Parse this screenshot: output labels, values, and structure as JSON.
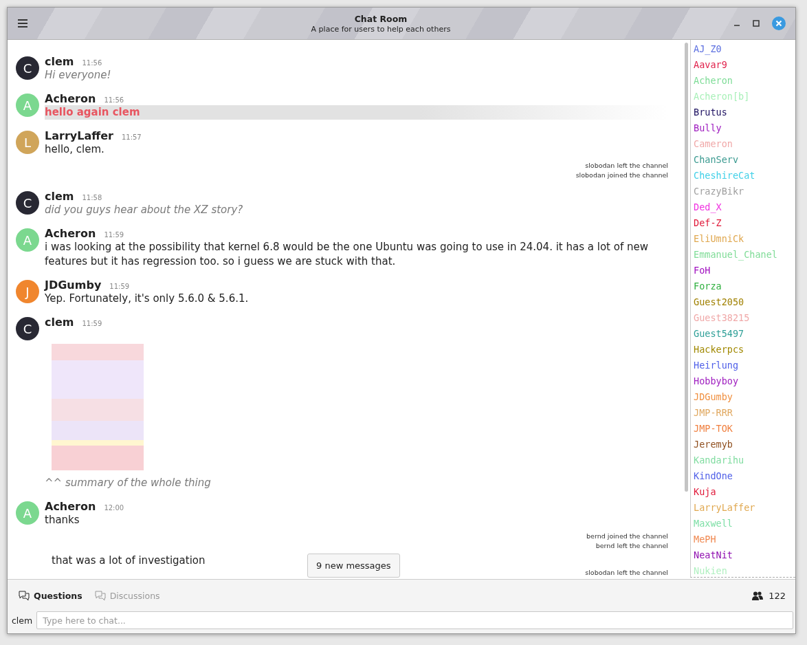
{
  "window": {
    "title": "Chat Room",
    "subtitle": "A place for users to help each others"
  },
  "feed": [
    {
      "kind": "message",
      "avatar": "C",
      "color": "#282833",
      "name": "clem",
      "time": "11:56",
      "parts": [
        {
          "kind": "emote",
          "text": "Hi everyone!"
        }
      ]
    },
    {
      "kind": "message",
      "avatar": "A",
      "color": "#7bd88f",
      "name": "Acheron",
      "time": "11:56",
      "parts": [
        {
          "kind": "highlight",
          "text": "hello again clem"
        }
      ]
    },
    {
      "kind": "message",
      "avatar": "L",
      "color": "#d0a55a",
      "name": "LarryLaffer",
      "time": "11:57",
      "parts": [
        {
          "kind": "text",
          "text": "hello, clem."
        }
      ]
    },
    {
      "kind": "notice",
      "text": "slobodan left the channel"
    },
    {
      "kind": "notice",
      "text": "slobodan joined the channel"
    },
    {
      "kind": "message",
      "avatar": "C",
      "color": "#282833",
      "name": "clem",
      "time": "11:58",
      "parts": [
        {
          "kind": "emote",
          "text": "did you guys hear about the XZ story?"
        }
      ]
    },
    {
      "kind": "message",
      "avatar": "A",
      "color": "#7bd88f",
      "name": "Acheron",
      "time": "11:59",
      "parts": [
        {
          "kind": "text",
          "text": "i was looking at the possibility that kernel 6.8 would be the one Ubuntu was going to use in 24.04. it has a lot of new features but it has regression too. so i guess we are stuck with that."
        }
      ]
    },
    {
      "kind": "message",
      "avatar": "J",
      "color": "#f0862e",
      "name": "JDGumby",
      "time": "11:59",
      "parts": [
        {
          "kind": "text",
          "text": "Yep. Fortunately, it's only 5.6.0 & 5.6.1."
        }
      ]
    },
    {
      "kind": "message",
      "avatar": "C",
      "color": "#282833",
      "name": "clem",
      "time": "11:59",
      "parts": [
        {
          "kind": "image"
        },
        {
          "kind": "emote",
          "text": "^^ summary of the whole thing"
        }
      ]
    },
    {
      "kind": "message",
      "avatar": "A",
      "color": "#7bd88f",
      "name": "Acheron",
      "time": "12:00",
      "parts": [
        {
          "kind": "text",
          "text": "thanks"
        }
      ]
    },
    {
      "kind": "notice",
      "text": "bernd joined the channel"
    },
    {
      "kind": "notice",
      "text": "bernd left the channel"
    },
    {
      "kind": "continuation",
      "text": "that was a lot of investigation"
    },
    {
      "kind": "notice",
      "text": "slobodan left the channel"
    }
  ],
  "new_messages_button": "9 new messages",
  "users": [
    {
      "name": "AJ_Z0",
      "color": "#5a6ee0"
    },
    {
      "name": "Aavar9",
      "color": "#e0204a"
    },
    {
      "name": "Acheron",
      "color": "#7ddc96"
    },
    {
      "name": "Acheron[b]",
      "color": "#a8f0b8"
    },
    {
      "name": "Brutus",
      "color": "#1c1060"
    },
    {
      "name": "Bully",
      "color": "#a020c0"
    },
    {
      "name": "Cameron",
      "color": "#f0a8a8"
    },
    {
      "name": "ChanServ",
      "color": "#3a9a90"
    },
    {
      "name": "CheshireCat",
      "color": "#40d0e8"
    },
    {
      "name": "CrazyBikr",
      "color": "#a0a0a0"
    },
    {
      "name": "Ded_X",
      "color": "#f030e0"
    },
    {
      "name": "Def-Z",
      "color": "#e01838"
    },
    {
      "name": "EliUmniCk",
      "color": "#e0a850"
    },
    {
      "name": "Emmanuel_Chanel",
      "color": "#80dc98"
    },
    {
      "name": "FoH",
      "color": "#a010c0"
    },
    {
      "name": "Forza",
      "color": "#30b040"
    },
    {
      "name": "Guest2050",
      "color": "#a08000"
    },
    {
      "name": "Guest38215",
      "color": "#f0a8a8"
    },
    {
      "name": "Guest5497",
      "color": "#30a098"
    },
    {
      "name": "Hackerpcs",
      "color": "#a08800"
    },
    {
      "name": "Heirlung",
      "color": "#5060e8"
    },
    {
      "name": "Hobbyboy",
      "color": "#a020c0"
    },
    {
      "name": "JDGumby",
      "color": "#f09040"
    },
    {
      "name": "JMP-RRR",
      "color": "#e0a860"
    },
    {
      "name": "JMP-TOK",
      "color": "#f08040"
    },
    {
      "name": "Jeremyb",
      "color": "#905020"
    },
    {
      "name": "Kandarihu",
      "color": "#80dca0"
    },
    {
      "name": "KindOne",
      "color": "#5060e8"
    },
    {
      "name": "Kuja",
      "color": "#e01838"
    },
    {
      "name": "LarryLaffer",
      "color": "#e0a850"
    },
    {
      "name": "Maxwell",
      "color": "#80e0a8"
    },
    {
      "name": "MePH",
      "color": "#f08850"
    },
    {
      "name": "NeatNit",
      "color": "#9010b0"
    },
    {
      "name": "Nukien",
      "color": "#b0f0c0"
    }
  ],
  "tabs": [
    {
      "label": "Questions",
      "selected": true
    },
    {
      "label": "Discussions",
      "selected": false
    }
  ],
  "user_count": "122",
  "input": {
    "nick": "clem",
    "placeholder": "Type here to chat..."
  }
}
